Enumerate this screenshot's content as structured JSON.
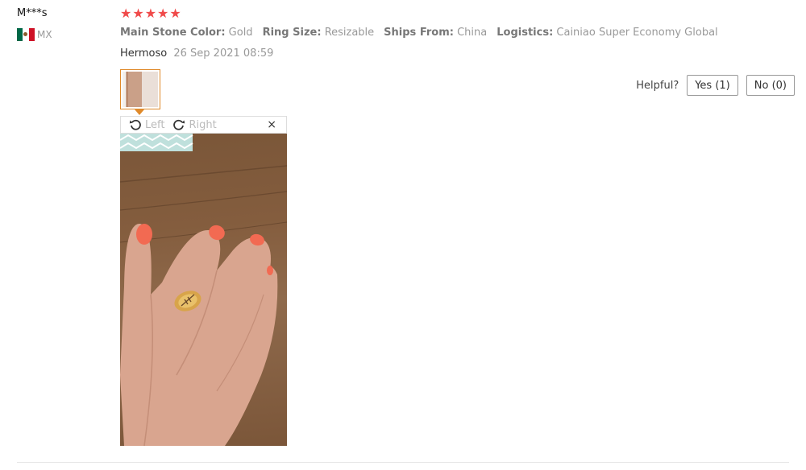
{
  "review": {
    "user_name": "M***s",
    "country_code": "MX",
    "rating": 5,
    "stars": [
      "★",
      "★",
      "★",
      "★",
      "★"
    ],
    "attributes": [
      {
        "label": "Main Stone Color:",
        "value": "Gold"
      },
      {
        "label": "Ring Size:",
        "value": "Resizable"
      },
      {
        "label": "Ships From:",
        "value": "China"
      },
      {
        "label": "Logistics:",
        "value": "Cainiao Super Economy Global"
      }
    ],
    "text": "Hermoso",
    "date": "26 Sep 2021 08:59"
  },
  "helpful": {
    "label": "Helpful?",
    "yes_label": "Yes (1)",
    "no_label": "No (0)"
  },
  "viewer": {
    "rotate_left_label": "Left",
    "rotate_right_label": "Right",
    "close_glyph": "×"
  },
  "colors": {
    "star": "#f04a4a",
    "thumb_border": "#e08a2a"
  }
}
